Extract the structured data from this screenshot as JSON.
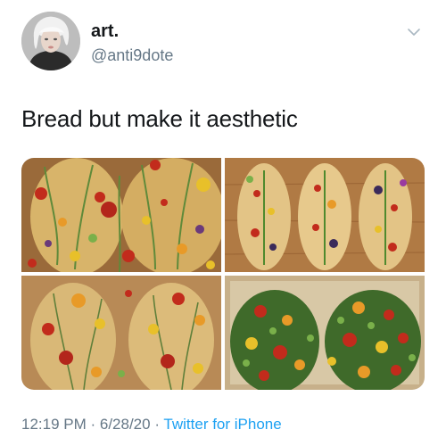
{
  "user": {
    "name": "art.",
    "handle": "@anti9dote",
    "avatar_icon": "profile-avatar"
  },
  "tweet": {
    "text": "Bread but make it aesthetic"
  },
  "media": [
    {
      "icon": "focaccia-flower-art-photo"
    },
    {
      "icon": "three-focaccia-loaves-photo"
    },
    {
      "icon": "two-focaccia-loaves-photo"
    },
    {
      "icon": "vegetable-garden-focaccia-photo"
    }
  ],
  "meta": {
    "time": "12:19 PM",
    "separator1": " · ",
    "date": "6/28/20",
    "separator2": " · ",
    "source": "Twitter for iPhone"
  },
  "colors": {
    "text": "#14171a",
    "secondary": "#657786",
    "link": "#1da1f2"
  }
}
